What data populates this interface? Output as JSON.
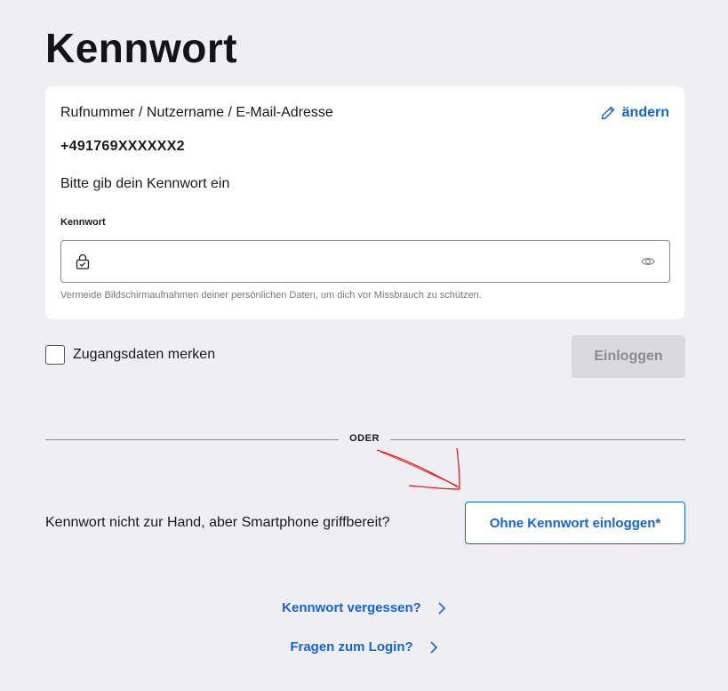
{
  "page": {
    "title": "Kennwort"
  },
  "account": {
    "label": "Rufnummer / Nutzername / E-Mail-Adresse",
    "edit_label": "ändern",
    "value": "+491769XXXXXX2"
  },
  "password": {
    "prompt": "Bitte gib dein Kennwort ein",
    "label": "Kennwort",
    "value": "",
    "hint": "Vermeide Bildschirmaufnahmen deiner persönlichen Daten, um dich vor Missbrauch zu schützen."
  },
  "remember": {
    "label": "Zugangsdaten merken",
    "checked": false
  },
  "login_button": {
    "label": "Einloggen",
    "disabled": true
  },
  "divider": {
    "text": "ODER"
  },
  "passwordless": {
    "question": "Kennwort nicht zur Hand, aber Smartphone griffbereit?",
    "button_label": "Ohne Kennwort einloggen*"
  },
  "links": {
    "forgot_password": "Kennwort vergessen?",
    "login_questions": "Fragen zum Login?"
  },
  "icons": {
    "edit": "pencil-icon",
    "lock": "lock-icon",
    "visibility": "eye-icon",
    "chevron": "chevron-right-icon"
  },
  "colors": {
    "background": "#efeff3",
    "accent": "#1763d0",
    "disabled_button": "#d9d9de",
    "annotation": "#e02020"
  }
}
